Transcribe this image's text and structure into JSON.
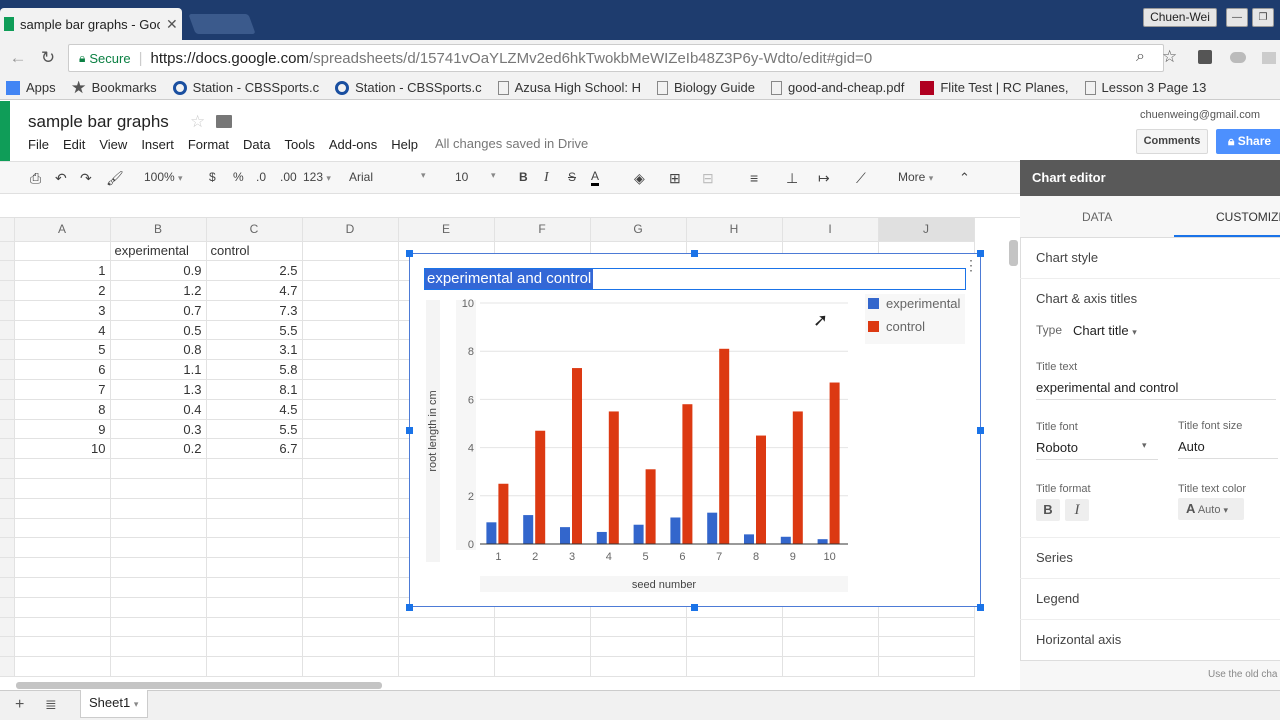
{
  "browser": {
    "tab_title": "sample bar graphs - Goo",
    "tab_close": "✕",
    "user": "Chuen-Wei",
    "secure_label": "Secure",
    "url_host": "https://docs.google.com",
    "url_path": "/spreadsheets/d/15741vOaYLZMv2ed6hkTwokbMeWIZeIb48Z3P6y-Wdto/edit#gid=0",
    "bookmarks": [
      {
        "label": "Apps",
        "icon": "apps-grid-icon",
        "color": "#4285f4"
      },
      {
        "label": "Bookmarks",
        "icon": "star-icon",
        "color": "#555555"
      },
      {
        "label": "Station - CBSSports.c",
        "icon": "cbs-eye-icon",
        "color": "#1a4fa0"
      },
      {
        "label": "Station - CBSSports.c",
        "icon": "cbs-eye-icon",
        "color": "#1a4fa0"
      },
      {
        "label": "Azusa High School: H",
        "icon": "page-icon",
        "color": "#888888"
      },
      {
        "label": "Biology Guide",
        "icon": "page-icon",
        "color": "#888888"
      },
      {
        "label": "good-and-cheap.pdf",
        "icon": "page-icon",
        "color": "#888888"
      },
      {
        "label": "Flite Test | RC Planes,",
        "icon": "flitetest-icon",
        "color": "#b00020"
      },
      {
        "label": "Lesson 3 Page 13",
        "icon": "page-icon",
        "color": "#888888"
      }
    ]
  },
  "sheets": {
    "title": "sample bar graphs",
    "menu": [
      "File",
      "Edit",
      "View",
      "Insert",
      "Format",
      "Data",
      "Tools",
      "Add-ons",
      "Help"
    ],
    "saved_status": "All changes saved in Drive",
    "email": "chuenweing@gmail.com",
    "comments_label": "Comments",
    "share_label": "Share",
    "toolbar": {
      "zoom": "100%",
      "currency": "$",
      "percent": "%",
      "dec_less": ".0",
      "dec_more": ".00",
      "format_more": "123",
      "font": "Arial",
      "font_size": "10",
      "bold": "B",
      "italic": "I",
      "strike": "S",
      "text_color": "A",
      "more": "More"
    },
    "columns": [
      "A",
      "B",
      "C",
      "D",
      "E",
      "F",
      "G",
      "H",
      "I",
      "J"
    ],
    "header_row": [
      "",
      "experimental",
      "control"
    ],
    "rows": [
      [
        "1",
        "0.9",
        "2.5"
      ],
      [
        "2",
        "1.2",
        "4.7"
      ],
      [
        "3",
        "0.7",
        "7.3"
      ],
      [
        "4",
        "0.5",
        "5.5"
      ],
      [
        "5",
        "0.8",
        "3.1"
      ],
      [
        "6",
        "1.1",
        "5.8"
      ],
      [
        "7",
        "1.3",
        "8.1"
      ],
      [
        "8",
        "0.4",
        "4.5"
      ],
      [
        "9",
        "0.3",
        "5.5"
      ],
      [
        "10",
        "0.2",
        "6.7"
      ]
    ],
    "sheet_tab": "Sheet1"
  },
  "chart_data": {
    "type": "bar",
    "title": "experimental and control",
    "xlabel": "seed number",
    "ylabel": "root length in cm",
    "categories": [
      "1",
      "2",
      "3",
      "4",
      "5",
      "6",
      "7",
      "8",
      "9",
      "10"
    ],
    "series": [
      {
        "name": "experimental",
        "color": "#3366cc",
        "values": [
          0.9,
          1.2,
          0.7,
          0.5,
          0.8,
          1.1,
          1.3,
          0.4,
          0.3,
          0.2
        ]
      },
      {
        "name": "control",
        "color": "#dc3912",
        "values": [
          2.5,
          4.7,
          7.3,
          5.5,
          3.1,
          5.8,
          8.1,
          4.5,
          5.5,
          6.7
        ]
      }
    ],
    "ylim": [
      0,
      10
    ],
    "yticks": [
      "0",
      "2",
      "4",
      "6",
      "8",
      "10"
    ],
    "legend": "top-right",
    "grid": true
  },
  "editor": {
    "title": "Chart editor",
    "tabs": [
      "DATA",
      "CUSTOMIZE"
    ],
    "chart_style": "Chart style",
    "chart_axis_titles": "Chart & axis titles",
    "type_label": "Type",
    "type_value": "Chart title",
    "title_text_label": "Title text",
    "title_text_value": "experimental and control",
    "title_font_label": "Title font",
    "title_font_value": "Roboto",
    "title_font_size_label": "Title font size",
    "title_font_size_value": "Auto",
    "title_format_label": "Title format",
    "title_text_color_label": "Title text color",
    "title_text_color_value": "Auto",
    "series": "Series",
    "legend": "Legend",
    "horizontal_axis": "Horizontal axis",
    "old_chart_note": "Use the old cha"
  }
}
